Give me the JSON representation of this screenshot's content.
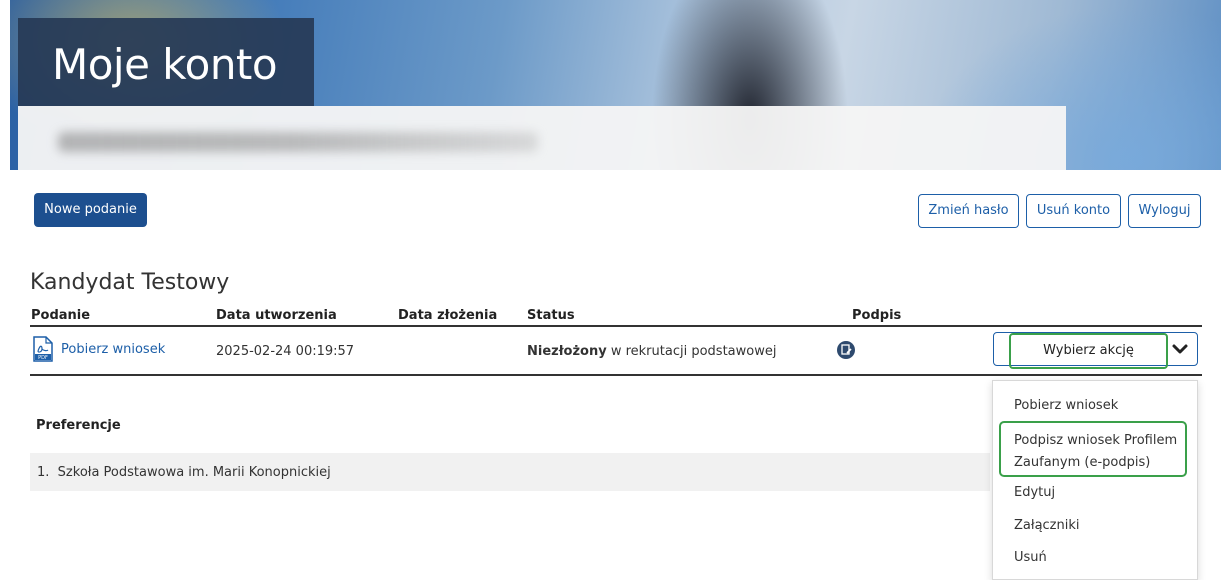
{
  "header": {
    "title": "Moje konto"
  },
  "toolbar": {
    "new_application": "Nowe podanie",
    "change_password": "Zmień hasło",
    "delete_account": "Usuń konto",
    "logout": "Wyloguj"
  },
  "candidate": {
    "name": "Kandydat Testowy"
  },
  "table": {
    "columns": [
      "Podanie",
      "Data utworzenia",
      "Data złożenia",
      "Status",
      "Podpis"
    ],
    "rows": [
      {
        "application": "Pobierz wniosek",
        "created": "2025-02-24 00:19:57",
        "submitted": "",
        "status_bold": "Niezłożony",
        "status_rest": " w rekrutacji podstawowej",
        "signature_icon": "signature-icon"
      }
    ]
  },
  "action_select": {
    "value": "Wybierz akcję",
    "options": [
      "Pobierz wniosek",
      "Podpisz wniosek Profilem Zaufanym (e-podpis)",
      "Edytuj",
      "Załączniki",
      "Usuń"
    ]
  },
  "preferences": {
    "title": "Preferencje",
    "items": [
      {
        "index": "1.",
        "school": "Szkoła Podstawowa im. Marii Konopnickiej"
      }
    ]
  },
  "colors": {
    "primary": "#1d4f8f",
    "link": "#1d5fa8",
    "highlight": "#3aa04a"
  }
}
